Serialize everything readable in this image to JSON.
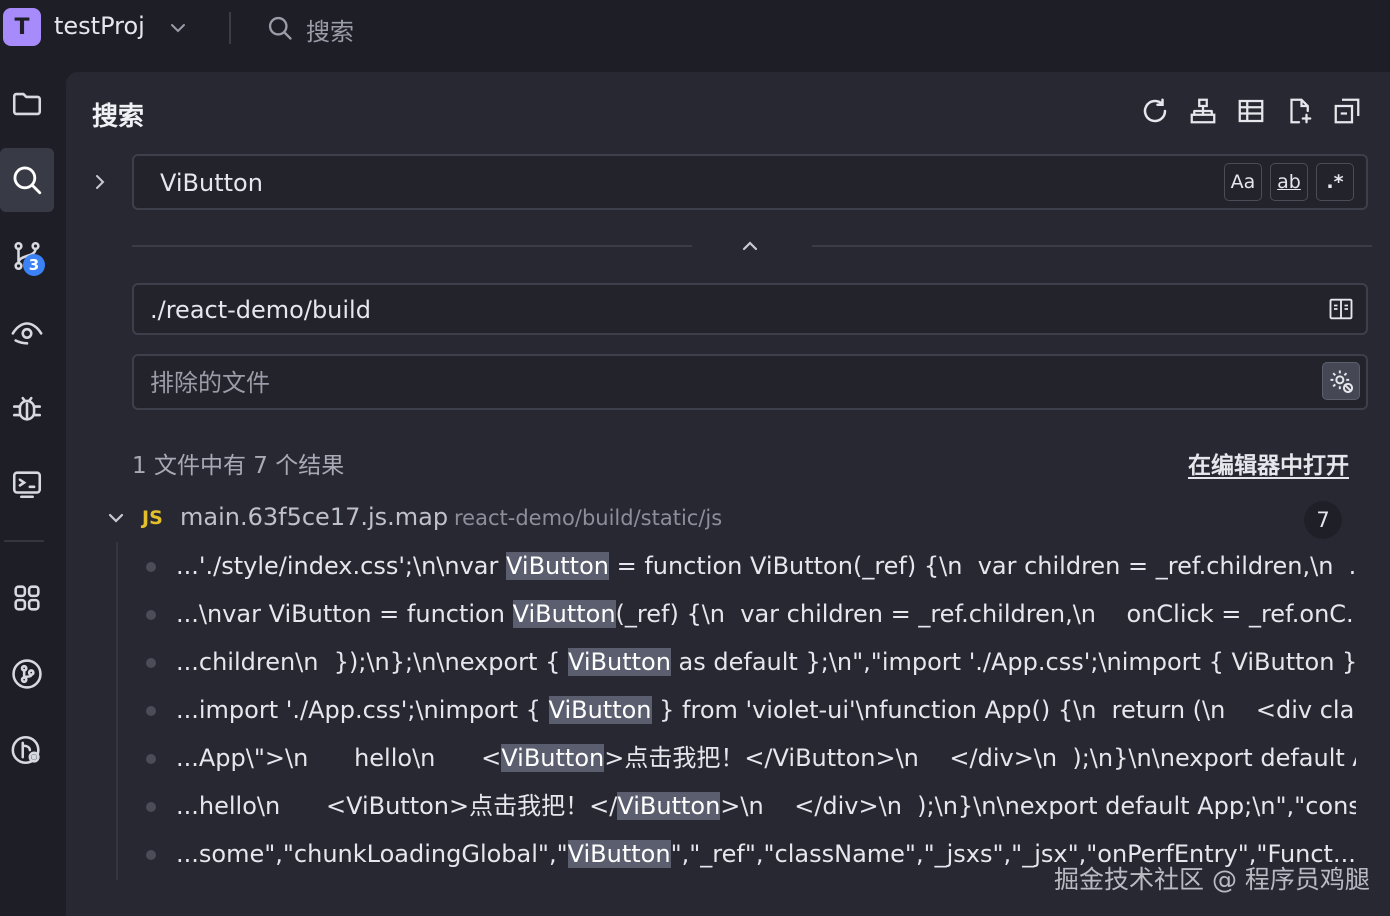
{
  "project": {
    "initial": "T",
    "name": "testProj"
  },
  "topbar": {
    "search_label": "搜索"
  },
  "activity": {
    "git_badge": "3"
  },
  "panel": {
    "title": "搜索",
    "search": {
      "value": "ViButton",
      "options": {
        "match_case": "Aa",
        "whole_word": "ab",
        "regex": ".*"
      }
    },
    "include": {
      "value": "./react-demo/build"
    },
    "exclude": {
      "placeholder": "排除的文件"
    },
    "summary": "1 文件中有 7 个结果",
    "open_in_editor": "在编辑器中打开",
    "file": {
      "lang": "JS",
      "name": "main.63f5ce17.js.map",
      "path": "react-demo/build/static/js",
      "count": "7"
    },
    "results": [
      {
        "before": "...'./style/index.css';\\n\\nvar ",
        "match": "ViButton",
        "after": " = function ViButton(_ref) {\\n  var children = _ref.children,\\n  ..."
      },
      {
        "before": "...\\nvar ViButton = function ",
        "match": "ViButton",
        "after": "(_ref) {\\n  var children = _ref.children,\\n    onClick = _ref.onC..."
      },
      {
        "before": "...children\\n  });\\n};\\n\\nexport { ",
        "match": "ViButton",
        "after": " as default };\\n\",\"import './App.css';\\nimport { ViButton } f..."
      },
      {
        "before": "...import './App.css';\\nimport { ",
        "match": "ViButton",
        "after": " } from 'violet-ui'\\nfunction App() {\\n  return (\\n    <div cla..."
      },
      {
        "before": "...App\\\">\\n      hello\\n      <",
        "match": "ViButton",
        "after": ">点击我把！</ViButton>\\n    </div>\\n  );\\n}\\n\\nexport default A..."
      },
      {
        "before": "...hello\\n      <ViButton>点击我把！</",
        "match": "ViButton",
        "after": ">\\n    </div>\\n  );\\n}\\n\\nexport default App;\\n\",\"cons..."
      },
      {
        "before": "...some\",\"chunkLoadingGlobal\",\"",
        "match": "ViButton",
        "after": "\",\"_ref\",\"className\",\"_jsxs\",\"_jsx\",\"onPerfEntry\",\"Funct..."
      }
    ]
  },
  "watermark": "掘金技术社区 @ 程序员鸡腿"
}
